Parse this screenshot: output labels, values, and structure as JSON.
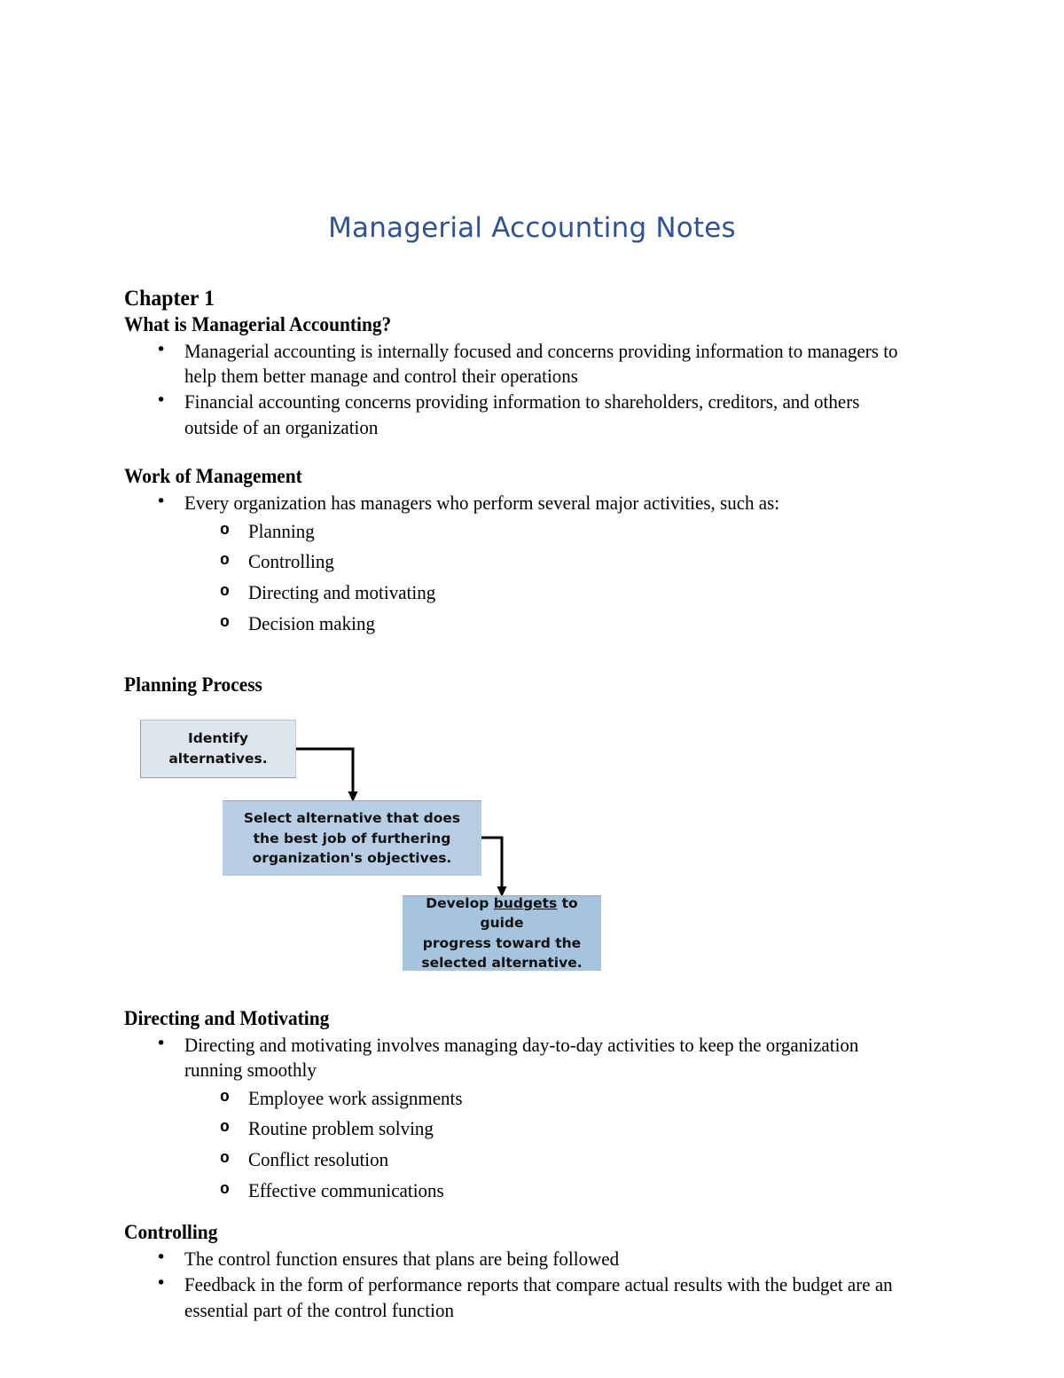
{
  "document": {
    "title": "Managerial Accounting Notes",
    "title_color": "#31538F"
  },
  "sections": {
    "chapter": "Chapter 1",
    "s1": {
      "heading": "What is Managerial Accounting?",
      "bullets": [
        "Managerial accounting is internally focused and concerns providing information to managers to help them better manage and control their operations",
        "Financial accounting concerns providing information to shareholders, creditors, and others outside of an organization"
      ]
    },
    "s2": {
      "heading": "Work of Management",
      "bullets": [
        "Every organization has managers who perform several major activities, such as:"
      ],
      "subbullets": [
        "Planning",
        "Controlling",
        "Directing and motivating",
        "Decision making"
      ]
    },
    "s3": {
      "heading": "Planning Process"
    },
    "s4": {
      "heading": "Directing and Motivating",
      "bullets": [
        "Directing and motivating involves managing day-to-day activities to keep the organization running smoothly"
      ],
      "subbullets": [
        "Employee work assignments",
        "Routine problem solving",
        "Conflict resolution",
        "Effective communications"
      ]
    },
    "s5": {
      "heading": "Controlling",
      "bullets": [
        "The control function ensures that plans are being followed",
        "Feedback in the form of performance reports that compare actual results with the budget are an essential part of the control function"
      ]
    }
  },
  "diagram": {
    "name": "planning-process-flowchart",
    "boxes": [
      {
        "id": "identify-alternatives",
        "lines": [
          "Identify",
          "alternatives."
        ],
        "fill": "#dde6ee"
      },
      {
        "id": "select-alternative",
        "lines": [
          "Select alternative that does",
          "the best job of furthering",
          "organization's objectives."
        ],
        "fill": "#b7cee4"
      },
      {
        "id": "develop-budgets",
        "text_before": "Develop ",
        "emphasis": "budgets",
        "text_after": " to guide",
        "lines": [
          "progress toward the",
          "selected alternative."
        ],
        "fill": "#a7c4df"
      }
    ],
    "connectors": [
      {
        "from": "identify-alternatives",
        "to": "select-alternative"
      },
      {
        "from": "select-alternative",
        "to": "develop-budgets"
      }
    ]
  }
}
